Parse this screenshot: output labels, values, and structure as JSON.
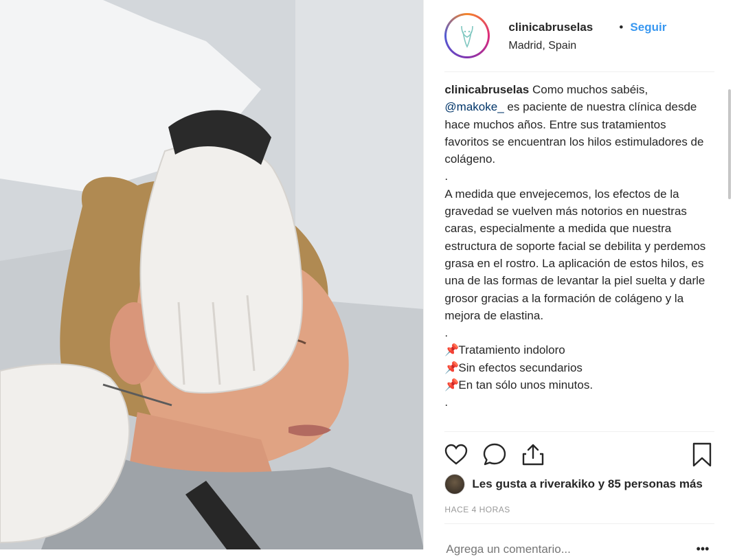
{
  "post": {
    "username": "clinicabruselas",
    "separator": "•",
    "follow_label": "Seguir",
    "location": "Madrid, Spain"
  },
  "caption": {
    "author": "clinicabruselas",
    "line1_rest": " Como muchos sabéis,",
    "mention": "@makoke_",
    "p1_rest": " es paciente de nuestra clínica desde hace muchos años. Entre sus tratamientos favoritos se encuentran los hilos estimuladores de colágeno.",
    "dot1": ".",
    "p2": "A medida que envejecemos, los efectos de la gravedad se vuelven más notorios en nuestras caras, especialmente a medida que nuestra estructura de soporte facial se debilita y perdemos grasa en el rostro. La aplicación de estos hilos, es una de las formas de levantar la piel suelta y darle grosor gracias a la formación de colágeno y la mejora de elastina.",
    "dot2": ".",
    "bullets": [
      "Tratamiento indoloro",
      "Sin efectos secundarios",
      "En tan sólo unos minutos."
    ],
    "pin_glyph": "📌",
    "dot3": "."
  },
  "actions": {
    "like_icon": "heart-icon",
    "comment_icon": "comment-icon",
    "share_icon": "share-icon",
    "save_icon": "bookmark-icon"
  },
  "likes_text": "Les gusta a riverakiko y 85 personas más",
  "timestamp": "HACE 4 HORAS",
  "comment_placeholder": "Agrega un comentario...",
  "more_glyph": "•••",
  "colors": {
    "accent": "#3897f0",
    "text": "#262626",
    "muted": "#999999",
    "border": "#efefef"
  }
}
